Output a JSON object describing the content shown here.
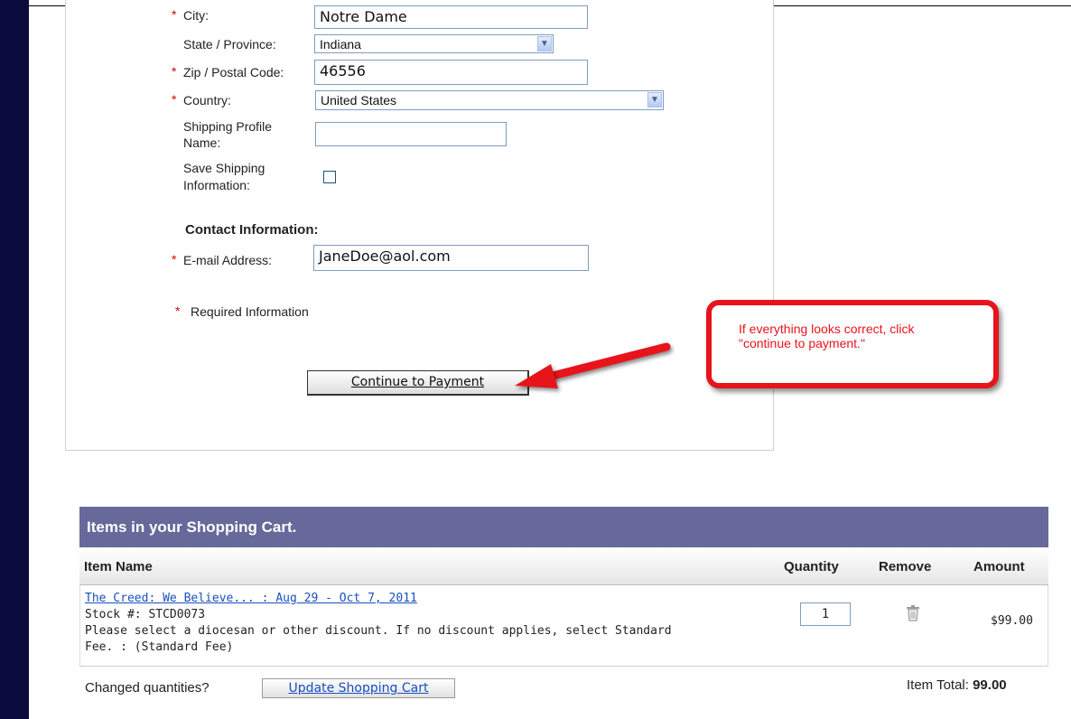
{
  "form": {
    "city": {
      "label": "City:",
      "value": "Notre Dame"
    },
    "state": {
      "label": "State / Province:",
      "value": "Indiana"
    },
    "zip": {
      "label": "Zip / Postal Code:",
      "value": "46556"
    },
    "country": {
      "label": "Country:",
      "value": "United States"
    },
    "profile_name": {
      "label_line1": "Shipping Profile",
      "label_line2": "Name:",
      "value": ""
    },
    "save_shipping": {
      "label_line1": "Save Shipping",
      "label_line2": "Information:",
      "checked": false
    },
    "contact_heading": "Contact Information:",
    "email": {
      "label": "E-mail Address:",
      "value": "JaneDoe@aol.com"
    },
    "required_note": "Required Information",
    "required_marker": "*",
    "continue_label": "Continue to Payment"
  },
  "callout": {
    "line1": "If everything looks correct, click",
    "line2": "\"continue to payment.\""
  },
  "cart": {
    "title": "Items in your Shopping Cart.",
    "columns": {
      "item_name": "Item Name",
      "quantity": "Quantity",
      "remove": "Remove",
      "amount": "Amount"
    },
    "items": [
      {
        "name": "The Creed: We Believe... : Aug 29 - Oct 7, 2011",
        "stock": "Stock #: STCD0073",
        "note_line1": "Please select a diocesan or other discount. If no discount applies, select Standard",
        "note_line2": "Fee. : (Standard Fee)",
        "quantity": "1",
        "amount": "$99.00"
      }
    ],
    "changed_quantities": "Changed quantities?",
    "update_label": "Update Shopping Cart",
    "item_total_label": "Item Total:",
    "item_total_value": "99.00"
  },
  "colors": {
    "cart_header": "#67699a",
    "left_bar": "#0a0a3c",
    "callout": "#e8141b",
    "required": "#d40000",
    "link": "#1a4fc0"
  }
}
